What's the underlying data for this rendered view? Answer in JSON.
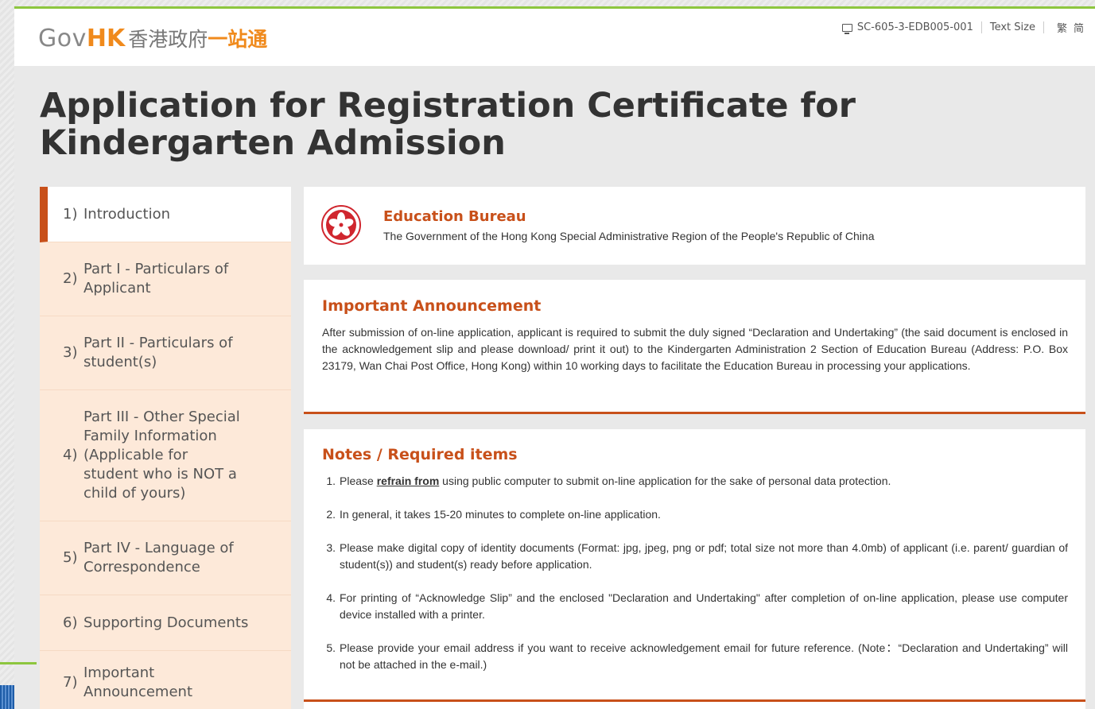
{
  "header": {
    "logo_gov": "Gov",
    "logo_hk": "HK",
    "logo_chinese_grey": "香港政府",
    "logo_chinese_orange": "一站通",
    "service_code": "SC-605-3-EDB005-001",
    "text_size_label": "Text Size",
    "lang_traditional": "繁",
    "lang_simplified": "简"
  },
  "page_title": "Application for Registration Certificate for Kindergarten Admission",
  "sidebar": {
    "items": [
      {
        "num": "1)",
        "label": "Introduction"
      },
      {
        "num": "2)",
        "label": "Part I - Particulars of Applicant"
      },
      {
        "num": "3)",
        "label": "Part II - Particulars of student(s)"
      },
      {
        "num": "4)",
        "label": "Part III - Other Special Family Information (Applicable for student who is NOT a child of yours)"
      },
      {
        "num": "5)",
        "label": "Part IV - Language of Correspondence"
      },
      {
        "num": "6)",
        "label": "Supporting Documents"
      },
      {
        "num": "7)",
        "label": "Important Announcement"
      }
    ]
  },
  "bureau": {
    "name": "Education Bureau",
    "subtitle": "The Government of the Hong Kong Special Administrative Region of the People's Republic of China"
  },
  "announcement": {
    "title": "Important Announcement",
    "text": "After submission of on-line application, applicant is required to submit the duly signed “Declaration and Undertaking” (the said document is enclosed in the acknowledgement slip and please download/ print it out) to the Kindergarten Administration 2 Section of Education Bureau (Address: P.O. Box 23179, Wan Chai Post Office, Hong Kong) within 10 working days to facilitate the Education Bureau in processing your applications."
  },
  "notes": {
    "title": "Notes / Required items",
    "item1_prefix": "Please ",
    "item1_emphasis": "refrain from",
    "item1_suffix": " using public computer to submit on-line application for the sake of personal data protection.",
    "items": [
      {
        "idx": "1."
      },
      {
        "idx": "2.",
        "text": "In general, it takes 15-20 minutes to complete on-line application."
      },
      {
        "idx": "3.",
        "text": "Please make digital copy of identity documents (Format: jpg, jpeg, png or pdf; total size not more than 4.0mb) of applicant (i.e. parent/ guardian of student(s)) and student(s) ready before application."
      },
      {
        "idx": "4.",
        "text": "For printing of “Acknowledge Slip” and the enclosed \"Declaration and Undertaking\" after completion of on-line application, please use computer device installed with a printer."
      },
      {
        "idx": "5.",
        "text": "Please provide your email address if you want to receive acknowledgement email for future reference. (Note：“Declaration and Undertaking” will not be attached in the e-mail.)"
      }
    ]
  },
  "colors": {
    "accent": "#c8501a",
    "nav_bg": "#fde9d9",
    "brand_orange": "#f08a1c",
    "brand_green": "#8dc63f"
  },
  "icons": [
    "monitor-icon",
    "hksar-emblem-icon"
  ]
}
